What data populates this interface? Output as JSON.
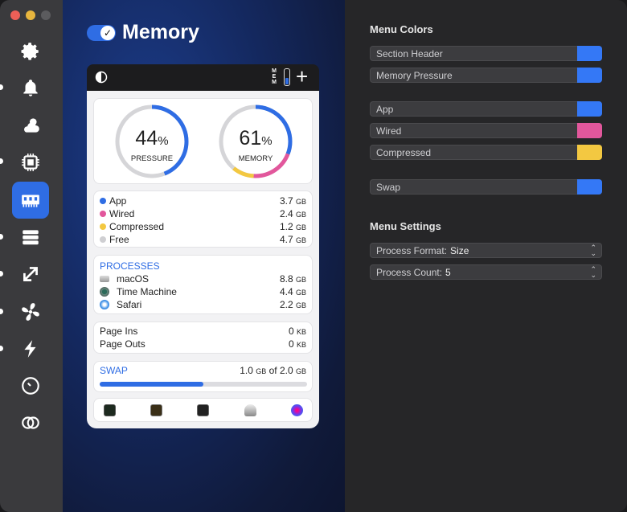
{
  "window": {
    "title": "Memory",
    "enabled": true
  },
  "sidebar": {
    "items": [
      {
        "icon": "gear-icon"
      },
      {
        "icon": "bell-icon"
      },
      {
        "icon": "weather-icon"
      },
      {
        "icon": "cpu-icon"
      },
      {
        "icon": "memory-icon",
        "active": true
      },
      {
        "icon": "disk-icon"
      },
      {
        "icon": "network-icon"
      },
      {
        "icon": "fan-icon"
      },
      {
        "icon": "power-icon"
      },
      {
        "icon": "clock-icon"
      },
      {
        "icon": "rings-icon"
      }
    ]
  },
  "menubar": {
    "mem_label": "MEM"
  },
  "gauges": {
    "pressure": {
      "value": "44",
      "unit": "%",
      "caption": "PRESSURE",
      "fraction": 0.44
    },
    "memory": {
      "value": "61",
      "unit": "%",
      "caption": "MEMORY",
      "fraction": 0.61
    }
  },
  "breakdown": [
    {
      "label": "App",
      "value": "3.7",
      "unit": "GB",
      "color": "#2f6de4"
    },
    {
      "label": "Wired",
      "value": "2.4",
      "unit": "GB",
      "color": "#e2579c"
    },
    {
      "label": "Compressed",
      "value": "1.2",
      "unit": "GB",
      "color": "#f3c841"
    },
    {
      "label": "Free",
      "value": "4.7",
      "unit": "GB",
      "color": "#cfcfd2"
    }
  ],
  "processes": {
    "title": "PROCESSES",
    "items": [
      {
        "name": "macOS",
        "value": "8.8",
        "unit": "GB",
        "icon": "macos-icon"
      },
      {
        "name": "Time Machine",
        "value": "4.4",
        "unit": "GB",
        "icon": "time-machine-icon"
      },
      {
        "name": "Safari",
        "value": "2.2",
        "unit": "GB",
        "icon": "safari-icon"
      }
    ]
  },
  "pages": [
    {
      "label": "Page Ins",
      "value": "0",
      "unit": "KB"
    },
    {
      "label": "Page Outs",
      "value": "0",
      "unit": "KB"
    }
  ],
  "swap": {
    "title": "SWAP",
    "used": "1.0",
    "used_unit": "GB",
    "of": "of",
    "total": "2.0",
    "total_unit": "GB",
    "fraction": 0.5
  },
  "dock_icons": [
    "activity-monitor-icon",
    "console-icon",
    "terminal-icon",
    "disk-utility-icon",
    "istat-icon"
  ],
  "settings": {
    "colors_header": "Menu Colors",
    "colors": [
      {
        "label": "Section Header",
        "color": "#3478f6"
      },
      {
        "label": "Memory Pressure",
        "color": "#3478f6"
      },
      {
        "label": "App",
        "color": "#3478f6"
      },
      {
        "label": "Wired",
        "color": "#e2579c"
      },
      {
        "label": "Compressed",
        "color": "#f3c841"
      },
      {
        "label": "Swap",
        "color": "#3478f6"
      }
    ],
    "menu_header": "Menu Settings",
    "menu": [
      {
        "label": "Process Format:",
        "value": "Size"
      },
      {
        "label": "Process Count:",
        "value": "5"
      }
    ]
  }
}
